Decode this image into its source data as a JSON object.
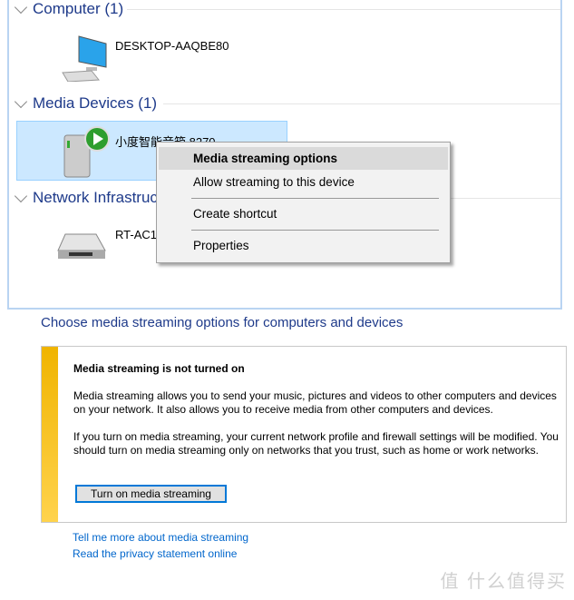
{
  "explorer": {
    "groups": [
      {
        "label": "Computer (1)",
        "devices": [
          {
            "name": "DESKTOP-AAQBE80",
            "icon": "computer-icon"
          }
        ]
      },
      {
        "label": "Media Devices (1)",
        "devices": [
          {
            "name": "小度智能音箱 8270",
            "icon": "media-device-icon",
            "selected": true
          }
        ]
      },
      {
        "label": "Network Infrastructure",
        "devices": [
          {
            "name": "RT-AC1",
            "icon": "router-icon"
          }
        ]
      }
    ]
  },
  "context_menu": {
    "items": [
      "Media streaming options",
      "Allow streaming to this device",
      "Create shortcut",
      "Properties"
    ],
    "highlighted": "Media streaming options"
  },
  "streaming": {
    "title": "Choose media streaming options for computers and devices",
    "heading": "Media streaming is not turned on",
    "para1": "Media streaming allows you to send your music, pictures and videos to other computers and devices on your network.  It also allows you to receive media from other computers and devices.",
    "para2": "If you turn on media streaming, your current network profile and firewall settings will be modified. You should turn on media streaming only on networks that you trust, such as home or work networks.",
    "button": "Turn on media streaming",
    "links": [
      "Tell me more about media streaming",
      "Read the privacy statement online"
    ],
    "accent": "#f0b400"
  },
  "watermark": "值 什么值得买"
}
